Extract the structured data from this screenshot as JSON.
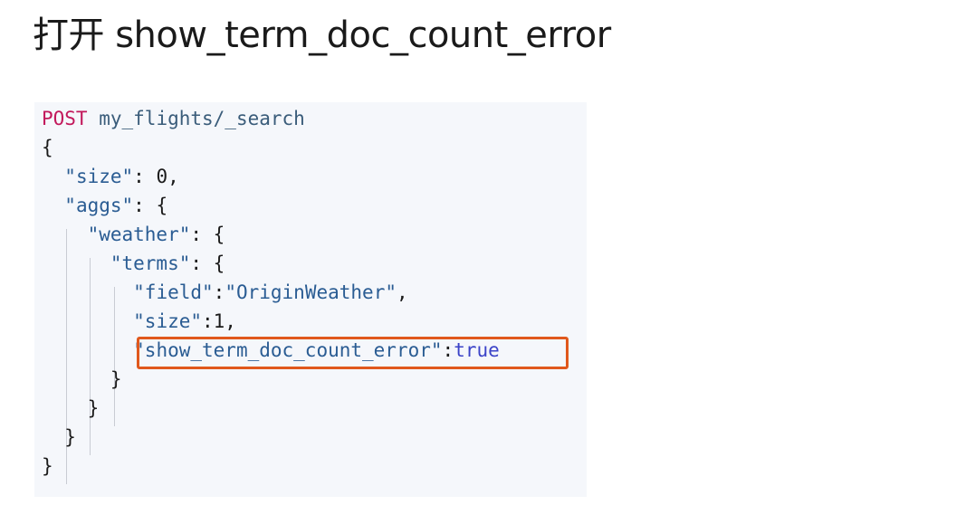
{
  "heading": "打开 show_term_doc_count_error",
  "code": {
    "method": "POST",
    "path": "my_flights/_search",
    "open_root": "{",
    "size_key": "\"size\"",
    "size_sep": ": ",
    "size_val": "0,",
    "aggs_key": "\"aggs\"",
    "aggs_sep": ": {",
    "weather_key": "\"weather\"",
    "weather_sep": ": {",
    "terms_key": "\"terms\"",
    "terms_sep": ": {",
    "field_key": "\"field\"",
    "field_colon": ":",
    "field_val": "\"OriginWeather\"",
    "field_comma": ",",
    "size2_key": "\"size\"",
    "size2_sep": ":1,",
    "stdce_key": "\"show_term_doc_count_error\"",
    "stdce_colon": ":",
    "stdce_val": "true",
    "close_terms": "}",
    "close_weather": "}",
    "close_aggs": "}",
    "close_root": "}"
  },
  "colors": {
    "highlight_border": "#e0581c",
    "keyword": "#c2185b",
    "string": "#2a5c93",
    "boolean": "#3b43c8",
    "panel_bg": "#f5f7fb"
  }
}
